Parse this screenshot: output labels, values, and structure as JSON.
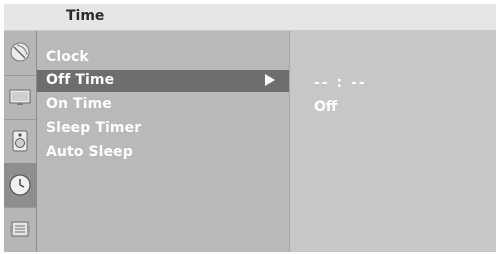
{
  "window": {
    "title": "Time"
  },
  "sidebar": {
    "icons": [
      {
        "name": "satellite-dish-icon"
      },
      {
        "name": "picture-monitor-icon"
      },
      {
        "name": "speaker-audio-icon"
      },
      {
        "name": "clock-icon",
        "active": true
      },
      {
        "name": "option-settings-icon"
      }
    ]
  },
  "menu": {
    "items": [
      {
        "label": "Clock"
      },
      {
        "label": "Off Time",
        "selected": true
      },
      {
        "label": "On Time"
      },
      {
        "label": "Sleep Timer"
      },
      {
        "label": "Auto Sleep"
      }
    ]
  },
  "submenu": {
    "time_value": "-- : --",
    "status_value": "Off"
  },
  "colors": {
    "selection": "#6e6e6e",
    "menu_background": "#b9b9b9",
    "text": "#ffffff"
  }
}
